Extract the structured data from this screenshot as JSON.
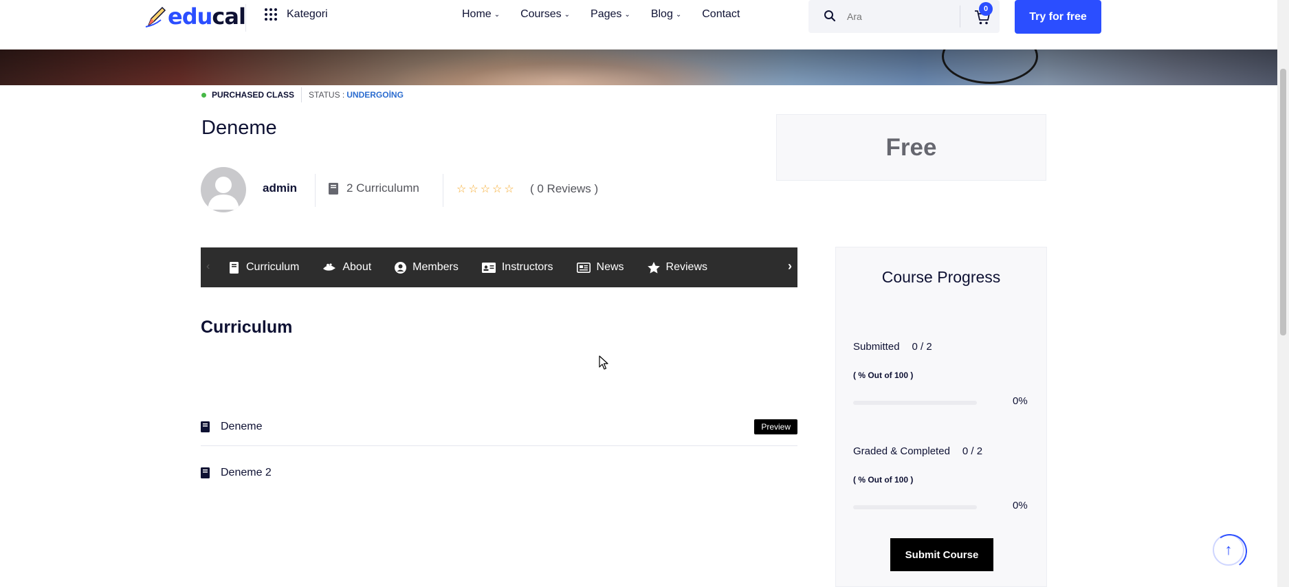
{
  "header": {
    "logo": {
      "part1": "edu",
      "part2": "cal"
    },
    "kategori_label": "Kategori",
    "nav": [
      {
        "label": "Home",
        "has_dropdown": true
      },
      {
        "label": "Courses",
        "has_dropdown": true
      },
      {
        "label": "Pages",
        "has_dropdown": true
      },
      {
        "label": "Blog",
        "has_dropdown": true
      },
      {
        "label": "Contact",
        "has_dropdown": false
      }
    ],
    "search_placeholder": "Ara",
    "cart_count": "0",
    "cta_label": "Try for free"
  },
  "course": {
    "purchased_label": "PURCHASED CLASS",
    "status_label": "STATUS :",
    "status_value": "UNDERGOİNG",
    "title": "Deneme",
    "author": "admin",
    "curriculum_meta": "2 Curriculumn",
    "rating": 0,
    "reviews_text": "( 0 Reviews )",
    "price": "Free"
  },
  "tabs": [
    {
      "label": "Curriculum",
      "icon": "book-icon"
    },
    {
      "label": "About",
      "icon": "rocket-icon"
    },
    {
      "label": "Members",
      "icon": "user-circle-icon"
    },
    {
      "label": "Instructors",
      "icon": "id-card-icon"
    },
    {
      "label": "News",
      "icon": "newspaper-icon"
    },
    {
      "label": "Reviews",
      "icon": "star-icon"
    }
  ],
  "curriculum": {
    "title": "Curriculum",
    "lessons": [
      {
        "title": "Deneme",
        "preview_label": "Preview"
      },
      {
        "title": "Deneme 2"
      }
    ]
  },
  "progress": {
    "title": "Course Progress",
    "submitted_label": "Submitted",
    "submitted_value": "0 / 2",
    "submitted_note": "( % Out of 100 )",
    "submitted_pct": "0%",
    "submitted_fraction": 0,
    "graded_label": "Graded & Completed",
    "graded_value": "0 / 2",
    "graded_note": "( % Out of 100 )",
    "graded_pct": "0%",
    "graded_fraction": 0,
    "submit_label": "Submit Course"
  },
  "colors": {
    "brand": "#2b4eff",
    "dark": "#0e1133",
    "tabs_bg": "#2d2d2d",
    "status_accent": "#2b6ccf",
    "star": "#f5a623"
  }
}
